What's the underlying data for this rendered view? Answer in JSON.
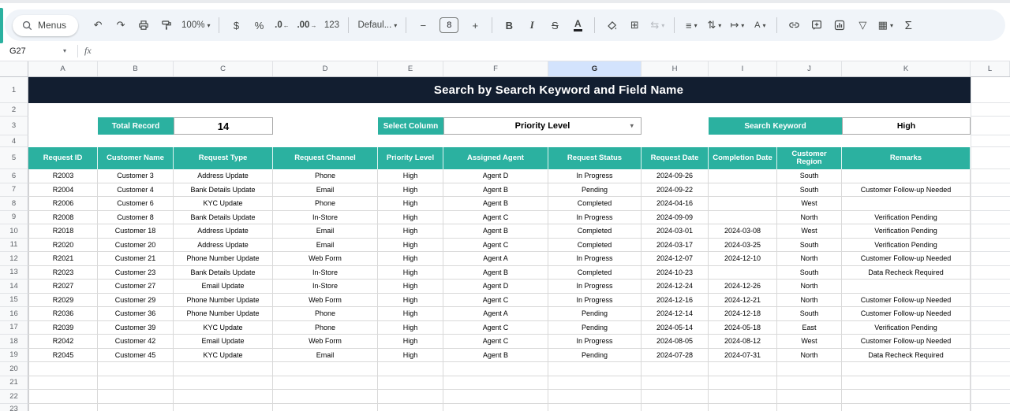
{
  "app": {
    "title": "Search by Search Keyword and Field Name"
  },
  "toolbar": {
    "menus_label": "Menus",
    "zoom_value": "100%",
    "font_family_value": "Defaul...",
    "font_size_value": "8",
    "glyphs": {
      "undo": "↶",
      "redo": "↷",
      "currency": "$",
      "percent": "%",
      "decimal_decrease": ".0",
      "decimal_increase": ".00",
      "number_format": "123",
      "minus": "−",
      "plus": "+",
      "bold": "B",
      "italic": "I",
      "strikethrough": "S",
      "text_color": "A",
      "borders": "⊞",
      "merge": "⇆",
      "align": "≡",
      "valign": "⇅",
      "wrap": "↦",
      "rotate": "A",
      "filter": "▽",
      "pivot": "▦",
      "sum": "Σ",
      "caret": "▾"
    }
  },
  "formula_bar": {
    "cell_reference": "G27",
    "fx_label": "fx"
  },
  "grid": {
    "column_letters": [
      "A",
      "B",
      "C",
      "D",
      "E",
      "F",
      "G",
      "H",
      "I",
      "J",
      "K",
      "L"
    ],
    "selected_column": "G",
    "row_count": 23
  },
  "controls": {
    "total_record_label": "Total Record",
    "total_record_value": "14",
    "select_column_label": "Select Column",
    "select_column_value": "Priority Level",
    "search_keyword_label": "Search Keyword",
    "search_keyword_value": "High"
  },
  "table": {
    "headers": [
      "Request ID",
      "Customer Name",
      "Request Type",
      "Request Channel",
      "Priority Level",
      "Assigned Agent",
      "Request Status",
      "Request Date",
      "Completion Date",
      "Customer Region",
      "Remarks"
    ],
    "rows": [
      [
        "R2003",
        "Customer 3",
        "Address Update",
        "Phone",
        "High",
        "Agent D",
        "In Progress",
        "2024-09-26",
        "",
        "South",
        ""
      ],
      [
        "R2004",
        "Customer 4",
        "Bank Details Update",
        "Email",
        "High",
        "Agent B",
        "Pending",
        "2024-09-22",
        "",
        "South",
        "Customer Follow-up Needed"
      ],
      [
        "R2006",
        "Customer 6",
        "KYC Update",
        "Phone",
        "High",
        "Agent B",
        "Completed",
        "2024-04-16",
        "",
        "West",
        ""
      ],
      [
        "R2008",
        "Customer 8",
        "Bank Details Update",
        "In-Store",
        "High",
        "Agent C",
        "In Progress",
        "2024-09-09",
        "",
        "North",
        "Verification Pending"
      ],
      [
        "R2018",
        "Customer 18",
        "Address Update",
        "Email",
        "High",
        "Agent B",
        "Completed",
        "2024-03-01",
        "2024-03-08",
        "West",
        "Verification Pending"
      ],
      [
        "R2020",
        "Customer 20",
        "Address Update",
        "Email",
        "High",
        "Agent C",
        "Completed",
        "2024-03-17",
        "2024-03-25",
        "South",
        "Verification Pending"
      ],
      [
        "R2021",
        "Customer 21",
        "Phone Number Update",
        "Web Form",
        "High",
        "Agent A",
        "In Progress",
        "2024-12-07",
        "2024-12-10",
        "North",
        "Customer Follow-up Needed"
      ],
      [
        "R2023",
        "Customer 23",
        "Bank Details Update",
        "In-Store",
        "High",
        "Agent B",
        "Completed",
        "2024-10-23",
        "",
        "South",
        "Data Recheck Required"
      ],
      [
        "R2027",
        "Customer 27",
        "Email Update",
        "In-Store",
        "High",
        "Agent D",
        "In Progress",
        "2024-12-24",
        "2024-12-26",
        "North",
        ""
      ],
      [
        "R2029",
        "Customer 29",
        "Phone Number Update",
        "Web Form",
        "High",
        "Agent C",
        "In Progress",
        "2024-12-16",
        "2024-12-21",
        "North",
        "Customer Follow-up Needed"
      ],
      [
        "R2036",
        "Customer 36",
        "Phone Number Update",
        "Phone",
        "High",
        "Agent A",
        "Pending",
        "2024-12-14",
        "2024-12-18",
        "South",
        "Customer Follow-up Needed"
      ],
      [
        "R2039",
        "Customer 39",
        "KYC Update",
        "Phone",
        "High",
        "Agent C",
        "Pending",
        "2024-05-14",
        "2024-05-18",
        "East",
        "Verification Pending"
      ],
      [
        "R2042",
        "Customer 42",
        "Email Update",
        "Web Form",
        "High",
        "Agent C",
        "In Progress",
        "2024-08-05",
        "2024-08-12",
        "West",
        "Customer Follow-up Needed"
      ],
      [
        "R2045",
        "Customer 45",
        "KYC Update",
        "Email",
        "High",
        "Agent B",
        "Pending",
        "2024-07-28",
        "2024-07-31",
        "North",
        "Data Recheck Required"
      ]
    ]
  },
  "colors": {
    "teal": "#2bb1a0",
    "banner_bg": "#121e30",
    "selected_column_bg": "#d3e3fd"
  }
}
